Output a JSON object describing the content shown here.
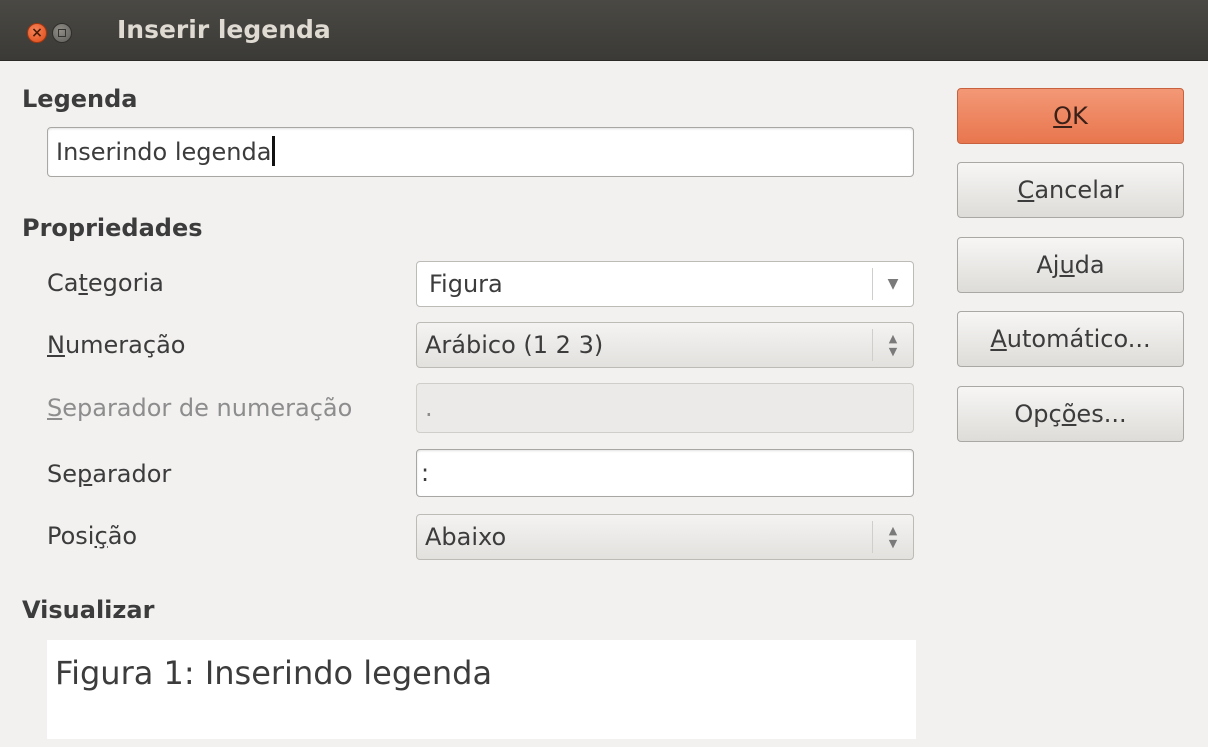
{
  "window": {
    "title": "Inserir legenda",
    "close_glyph": "×"
  },
  "caption": {
    "section_label": "Legenda",
    "value": "Inserindo legenda"
  },
  "properties": {
    "section_label": "Propriedades",
    "category": {
      "label_pre": "Ca",
      "label_mnemonic": "t",
      "label_post": "egoria",
      "value": "Figura",
      "arrow": "▼"
    },
    "numbering": {
      "label_pre": "",
      "label_mnemonic": "N",
      "label_post": "umeração",
      "value": "Arábico (1 2 3)"
    },
    "numbering_separator": {
      "label_pre": "",
      "label_mnemonic": "S",
      "label_post": "eparador de numeração",
      "value": "."
    },
    "separator": {
      "label_pre": "Se",
      "label_mnemonic": "p",
      "label_post": "arador",
      "value": ":"
    },
    "position": {
      "label_pre": "Posi",
      "label_mnemonic": "ç",
      "label_post": "ão",
      "value": "Abaixo"
    },
    "spin_glyphs": {
      "up": "▲",
      "down": "▼"
    }
  },
  "preview": {
    "section_label": "Visualizar",
    "text": "Figura 1: Inserindo legenda"
  },
  "buttons": {
    "ok": {
      "pre": "",
      "mnemonic": "O",
      "post": "K"
    },
    "cancel": {
      "pre": "",
      "mnemonic": "C",
      "post": "ancelar"
    },
    "help": {
      "pre": "Aj",
      "mnemonic": "u",
      "post": "da"
    },
    "auto": {
      "pre": "",
      "mnemonic": "A",
      "post": "utomático..."
    },
    "options": {
      "pre": "Opç",
      "mnemonic": "õ",
      "post": "es..."
    }
  },
  "colors": {
    "default_button": "#ea7d55",
    "titlebar": "#3f3e3a",
    "close_button": "#e95420"
  }
}
